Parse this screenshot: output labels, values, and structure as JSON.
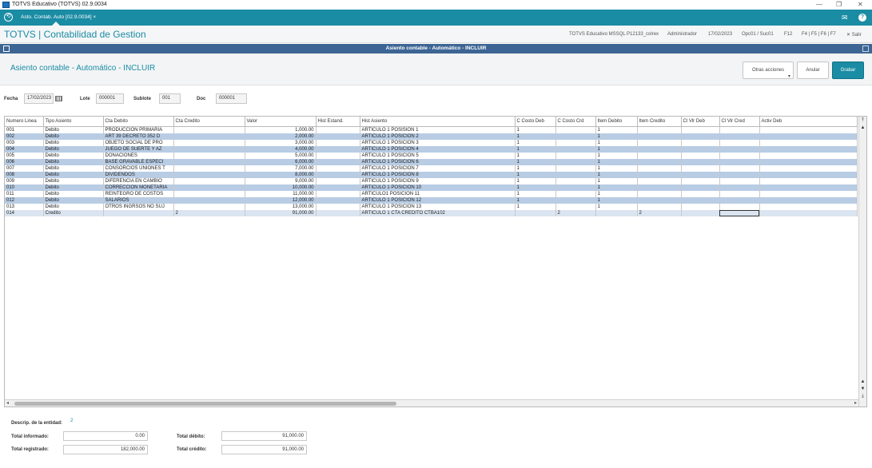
{
  "window": {
    "title": "TOTVS Educativo (TOTVS) 02.9.0034",
    "minimize": "—",
    "restore": "❐",
    "close": "✕"
  },
  "tabbar": {
    "home_glyph": "⟲",
    "active_tab": "Asto. Contab. Auto [02.9.0034]",
    "tab_close": "×",
    "mail_glyph": "✉",
    "help_glyph": "?"
  },
  "header": {
    "brand": "TOTVS | Contabilidad de Gestion",
    "env": "TOTVS Educativo MSSQL P12133_colrex",
    "user": "Administrador",
    "date": "17/02/2023",
    "branch": "Opc01 / Suc01",
    "f12": "F12",
    "fkeys": "F4 | F5 | F6 | F7",
    "exit": "✕ Salir"
  },
  "dialog": {
    "title": "Asiento contable - Automático - INCLUIR"
  },
  "page": {
    "title": "Asiento contable - Automático - INCLUIR",
    "actions": {
      "other_label": "Otras acciones",
      "cancel_label": "Anular",
      "save_label": "Grabar"
    }
  },
  "form": {
    "fecha_label": "Fecha",
    "fecha_value": "17/02/2023",
    "lote_label": "Lote",
    "lote_value": "000001",
    "sublote_label": "Sublote",
    "sublote_value": "001",
    "doc_label": "Doc",
    "doc_value": "000001"
  },
  "grid": {
    "columns": [
      "Numero Linea",
      "Tipo Asiento",
      "Cta Debito",
      "Cta Credito",
      "Valor",
      "Hist Estand.",
      "Hist Asiento",
      "C Costo Deb",
      "C Costo Crd",
      "Item Debito",
      "Item Credito",
      "Cl Vlr Deb",
      "Cl Vlr Cred",
      "Activ Deb"
    ],
    "rows": [
      [
        "001",
        "Debito",
        "PRODUCCION PRIMARIA",
        "",
        "1,000.00",
        "",
        "ARTICULO 1 POSISION 1",
        "1",
        "",
        "1",
        "",
        "",
        "",
        ""
      ],
      [
        "002",
        "Debito",
        "ART 39 DECRETO 352 D",
        "",
        "2,000.00",
        "",
        "ARTICULO 1 POSICION 2",
        "1",
        "",
        "1",
        "",
        "",
        "",
        ""
      ],
      [
        "003",
        "Debito",
        "OBJETO SOCIAL DE PRO",
        "",
        "3,000.00",
        "",
        "ARTICULO 1 POSICION 3",
        "1",
        "",
        "1",
        "",
        "",
        "",
        ""
      ],
      [
        "004",
        "Debito",
        "JUEGO DE SUERTE Y AZ",
        "",
        "4,000.00",
        "",
        "ARTICULO 1 POSICION 4",
        "1",
        "",
        "1",
        "",
        "",
        "",
        ""
      ],
      [
        "005",
        "Debito",
        "DONACIONES",
        "",
        "5,000.00",
        "",
        "ARTICULO 1 POSICION 5",
        "1",
        "",
        "1",
        "",
        "",
        "",
        ""
      ],
      [
        "006",
        "Debito",
        "BASE GRAVABLE ESPECI",
        "",
        "6,000.00",
        "",
        "ARTICULO 1 POSICION 6",
        "1",
        "",
        "1",
        "",
        "",
        "",
        ""
      ],
      [
        "007",
        "Debito",
        "CONSORCIOS UNIONES T",
        "",
        "7,000.00",
        "",
        "ARTICULO 1 POSICION 7",
        "1",
        "",
        "1",
        "",
        "",
        "",
        ""
      ],
      [
        "008",
        "Debito",
        "DIVIDENDOS",
        "",
        "8,000.00",
        "",
        "ARTICULO 1 POSICION 8",
        "1",
        "",
        "1",
        "",
        "",
        "",
        ""
      ],
      [
        "009",
        "Debito",
        "DIFERENCIA EN CAMBIO",
        "",
        "9,000.00",
        "",
        "ARTICULO 1 POSICION 9",
        "1",
        "",
        "1",
        "",
        "",
        "",
        ""
      ],
      [
        "010",
        "Debito",
        "CORRECCION MONETARIA",
        "",
        "10,000.00",
        "",
        "ARTICULO 1 POSICION 10",
        "1",
        "",
        "1",
        "",
        "",
        "",
        ""
      ],
      [
        "011",
        "Debito",
        "REINTEGRO DE COSTOS",
        "",
        "11,000.00",
        "",
        "ARTICULO1 POSICION 11",
        "1",
        "",
        "1",
        "",
        "",
        "",
        ""
      ],
      [
        "012",
        "Debito",
        "SALARIOS",
        "",
        "12,000.00",
        "",
        "ARTICULO 1 POSICION 12",
        "1",
        "",
        "1",
        "",
        "",
        "",
        ""
      ],
      [
        "013",
        "Debito",
        "OTROS INGRSOS NO SUJ",
        "",
        "13,000.00",
        "",
        "ARTICULO 1 POSICION 13",
        "1",
        "",
        "1",
        "",
        "",
        "",
        ""
      ],
      [
        "014",
        "Credito",
        "",
        "2",
        "91,000.00",
        "",
        "ARTICULO 1 CTA CREDITO CTBA102",
        "",
        "2",
        "",
        "2",
        "",
        "",
        ""
      ]
    ],
    "scroll": {
      "up": "▲",
      "down": "▼",
      "top": "⤒",
      "bottom": "⤓",
      "left": "◂",
      "right": "▸"
    }
  },
  "footer": {
    "desc_label": "Descrip. de la entidad:",
    "desc_value": "2",
    "informado_label": "Total informado:",
    "informado_value": "0.00",
    "registrado_label": "Total registrado:",
    "registrado_value": "182,000.00",
    "debito_label": "Total débito:",
    "debito_value": "91,000.00",
    "credito_label": "Total crédito:",
    "credito_value": "91,000.00"
  }
}
